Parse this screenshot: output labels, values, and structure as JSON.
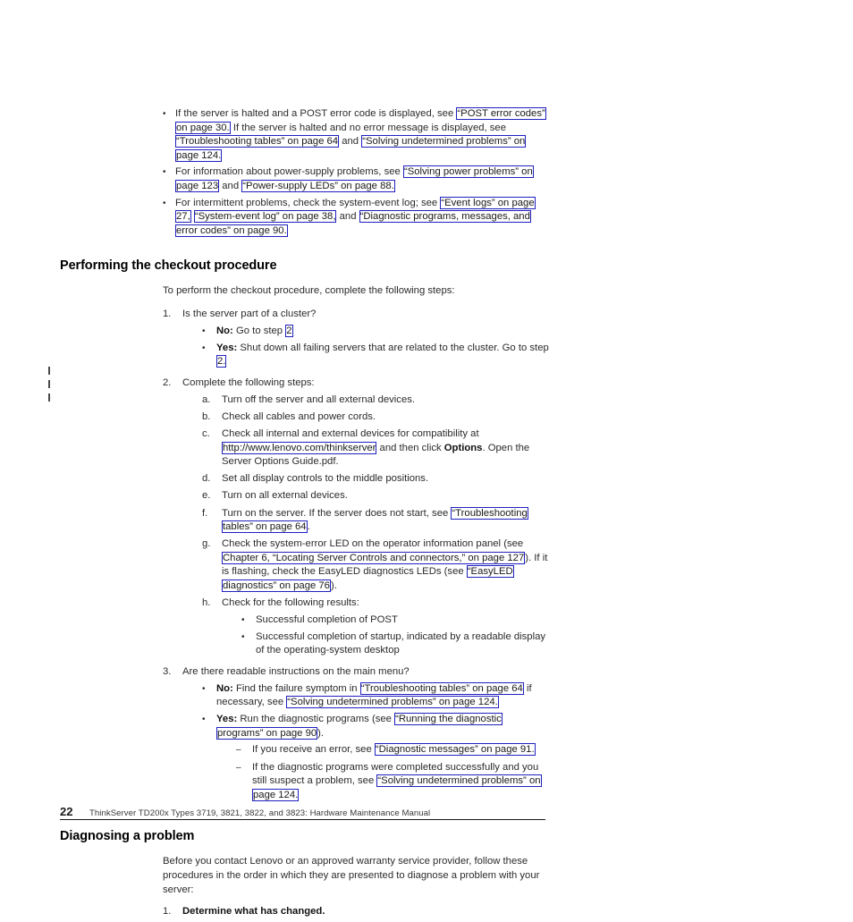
{
  "document": {
    "page_number": "22",
    "footer_text": "ThinkServer TD200x Types 3719, 3821, 3822, and 3823:  Hardware Maintenance Manual",
    "link_border_color": "#2020c0",
    "text_color": "#2b2b2b",
    "background_color": "#ffffff"
  },
  "top_bullets": [
    {
      "marker": "•",
      "parts": [
        {
          "type": "text",
          "text": "If the server is halted and a POST error code is displayed, see "
        },
        {
          "type": "link",
          "text": "“POST error codes” on page 30."
        },
        {
          "type": "text",
          "text": " If the server is halted and no error message is displayed, see "
        },
        {
          "type": "link",
          "text": "“Troubleshooting tables” on page 64"
        },
        {
          "type": "text",
          "text": " and "
        },
        {
          "type": "link",
          "text": "“Solving undetermined problems” on page 124."
        }
      ]
    },
    {
      "marker": "•",
      "parts": [
        {
          "type": "text",
          "text": "For information about power-supply problems, see "
        },
        {
          "type": "link",
          "text": "“Solving power problems” on page 123"
        },
        {
          "type": "text",
          "text": " and "
        },
        {
          "type": "link",
          "text": "“Power-supply LEDs” on page 88."
        }
      ]
    },
    {
      "marker": "•",
      "parts": [
        {
          "type": "text",
          "text": "For intermittent problems, check the system-event log; see "
        },
        {
          "type": "link",
          "text": "“Event logs” on page 27,"
        },
        {
          "type": "text",
          "text": " "
        },
        {
          "type": "link",
          "text": "“System-event log” on page 38,"
        },
        {
          "type": "text",
          "text": " and "
        },
        {
          "type": "link",
          "text": "“Diagnostic programs, messages, and error codes” on page 90."
        }
      ]
    }
  ],
  "section_checkout": {
    "heading": "Performing the checkout procedure",
    "intro": "To perform the checkout procedure, complete the following steps:",
    "step1": {
      "marker": "1.",
      "text": "Is the server part of a cluster?",
      "bullets": [
        {
          "marker": "•",
          "parts": [
            {
              "type": "bold",
              "text": "No:"
            },
            {
              "type": "text",
              "text": " Go to step "
            },
            {
              "type": "link",
              "text": "2"
            }
          ]
        },
        {
          "marker": "•",
          "parts": [
            {
              "type": "bold",
              "text": "Yes:"
            },
            {
              "type": "text",
              "text": " Shut down all failing servers that are related to the cluster. Go to step "
            },
            {
              "type": "link",
              "text": "2."
            }
          ]
        }
      ]
    },
    "step2": {
      "marker": "2.",
      "text": "Complete the following steps:",
      "substeps": [
        {
          "marker": "a.",
          "parts": [
            {
              "type": "text",
              "text": "Turn off the server and all external devices."
            }
          ]
        },
        {
          "marker": "b.",
          "parts": [
            {
              "type": "text",
              "text": "Check all cables and power cords."
            }
          ]
        },
        {
          "marker": "c.",
          "parts": [
            {
              "type": "text",
              "text": "Check all internal and external devices for compatibility at "
            },
            {
              "type": "link",
              "text": "http://www.lenovo.com/thinkserver"
            },
            {
              "type": "text",
              "text": " and then click "
            },
            {
              "type": "bold",
              "text": "Options"
            },
            {
              "type": "text",
              "text": ". Open the Server Options Guide.pdf."
            }
          ]
        },
        {
          "marker": "d.",
          "parts": [
            {
              "type": "text",
              "text": "Set all display controls to the middle positions."
            }
          ]
        },
        {
          "marker": "e.",
          "parts": [
            {
              "type": "text",
              "text": "Turn on all external devices."
            }
          ]
        },
        {
          "marker": "f.",
          "parts": [
            {
              "type": "text",
              "text": "Turn on the server. If the server does not start, see "
            },
            {
              "type": "link",
              "text": "“Troubleshooting tables” on page 64"
            },
            {
              "type": "text",
              "text": "."
            }
          ]
        },
        {
          "marker": "g.",
          "parts": [
            {
              "type": "text",
              "text": "Check the system-error LED on the operator information panel (see "
            },
            {
              "type": "link",
              "text": "Chapter 6, “Locating Server Controls and connectors,” on page 127"
            },
            {
              "type": "text",
              "text": "). If it is flashing, check the EasyLED diagnostics LEDs (see "
            },
            {
              "type": "link",
              "text": "“EasyLED diagnostics” on page 76"
            },
            {
              "type": "text",
              "text": ")."
            }
          ]
        },
        {
          "marker": "h.",
          "parts": [
            {
              "type": "text",
              "text": "Check for the following results:"
            }
          ],
          "bullets": [
            {
              "marker": "•",
              "text": "Successful completion of POST"
            },
            {
              "marker": "•",
              "text": "Successful completion of startup, indicated by a readable display of the operating-system desktop"
            }
          ]
        }
      ]
    },
    "step3": {
      "marker": "3.",
      "text": "Are there readable instructions on the main menu?",
      "bullets": [
        {
          "marker": "•",
          "parts": [
            {
              "type": "bold",
              "text": "No:"
            },
            {
              "type": "text",
              "text": " Find the failure symptom in "
            },
            {
              "type": "link",
              "text": "“Troubleshooting tables” on page 64"
            },
            {
              "type": "text",
              "text": " if necessary, see "
            },
            {
              "type": "link",
              "text": "“Solving undetermined problems” on page 124."
            }
          ]
        },
        {
          "marker": "•",
          "parts": [
            {
              "type": "bold",
              "text": "Yes:"
            },
            {
              "type": "text",
              "text": " Run the diagnostic programs (see "
            },
            {
              "type": "link",
              "text": "“Running the diagnostic programs” on page 90"
            },
            {
              "type": "text",
              "text": ")."
            }
          ],
          "dashes": [
            {
              "marker": "–",
              "parts": [
                {
                  "type": "text",
                  "text": "If you receive an error, see "
                },
                {
                  "type": "link",
                  "text": "“Diagnostic messages” on page 91."
                }
              ]
            },
            {
              "marker": "–",
              "parts": [
                {
                  "type": "text",
                  "text": "If the diagnostic programs were completed successfully and you still suspect a problem, see "
                },
                {
                  "type": "link",
                  "text": "“Solving undetermined problems” on page 124."
                }
              ]
            }
          ]
        }
      ]
    }
  },
  "section_diagnosing": {
    "heading": "Diagnosing a problem",
    "intro": "Before you contact Lenovo or an approved warranty service provider, follow these procedures in the order in which they are presented to diagnose a problem with your server:",
    "step1": {
      "marker": "1.",
      "text": "Determine what has changed."
    }
  }
}
